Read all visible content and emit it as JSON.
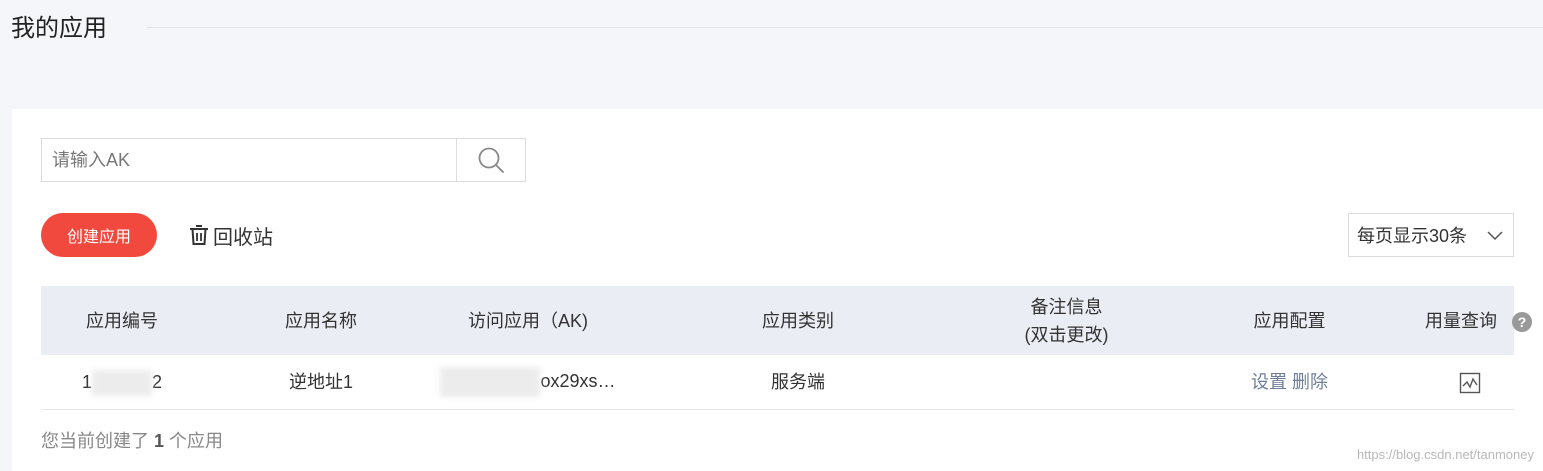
{
  "header": {
    "title": "我的应用"
  },
  "search": {
    "placeholder": "请输入AK",
    "icon": "search-icon"
  },
  "toolbar": {
    "create_label": "创建应用",
    "recycle_label": "回收站",
    "page_size_label": "每页显示30条",
    "accent_color": "#f1493d"
  },
  "table": {
    "headers": [
      "应用编号",
      "应用名称",
      "访问应用（AK)",
      "应用类别",
      "备注信息",
      "(双击更改)",
      "应用配置",
      "用量查询"
    ],
    "rows": [
      {
        "id_visible_prefix": "1",
        "id_visible_suffix": "2",
        "name": "逆地址1",
        "ak_visible": "ox29xs…",
        "category": "服务端",
        "note": "",
        "config_links": [
          "设置",
          "删除"
        ]
      }
    ]
  },
  "footer": {
    "prefix": "您当前创建了",
    "count": "1",
    "suffix": "个应用"
  },
  "watermark": "https://blog.csdn.net/tanmoney"
}
